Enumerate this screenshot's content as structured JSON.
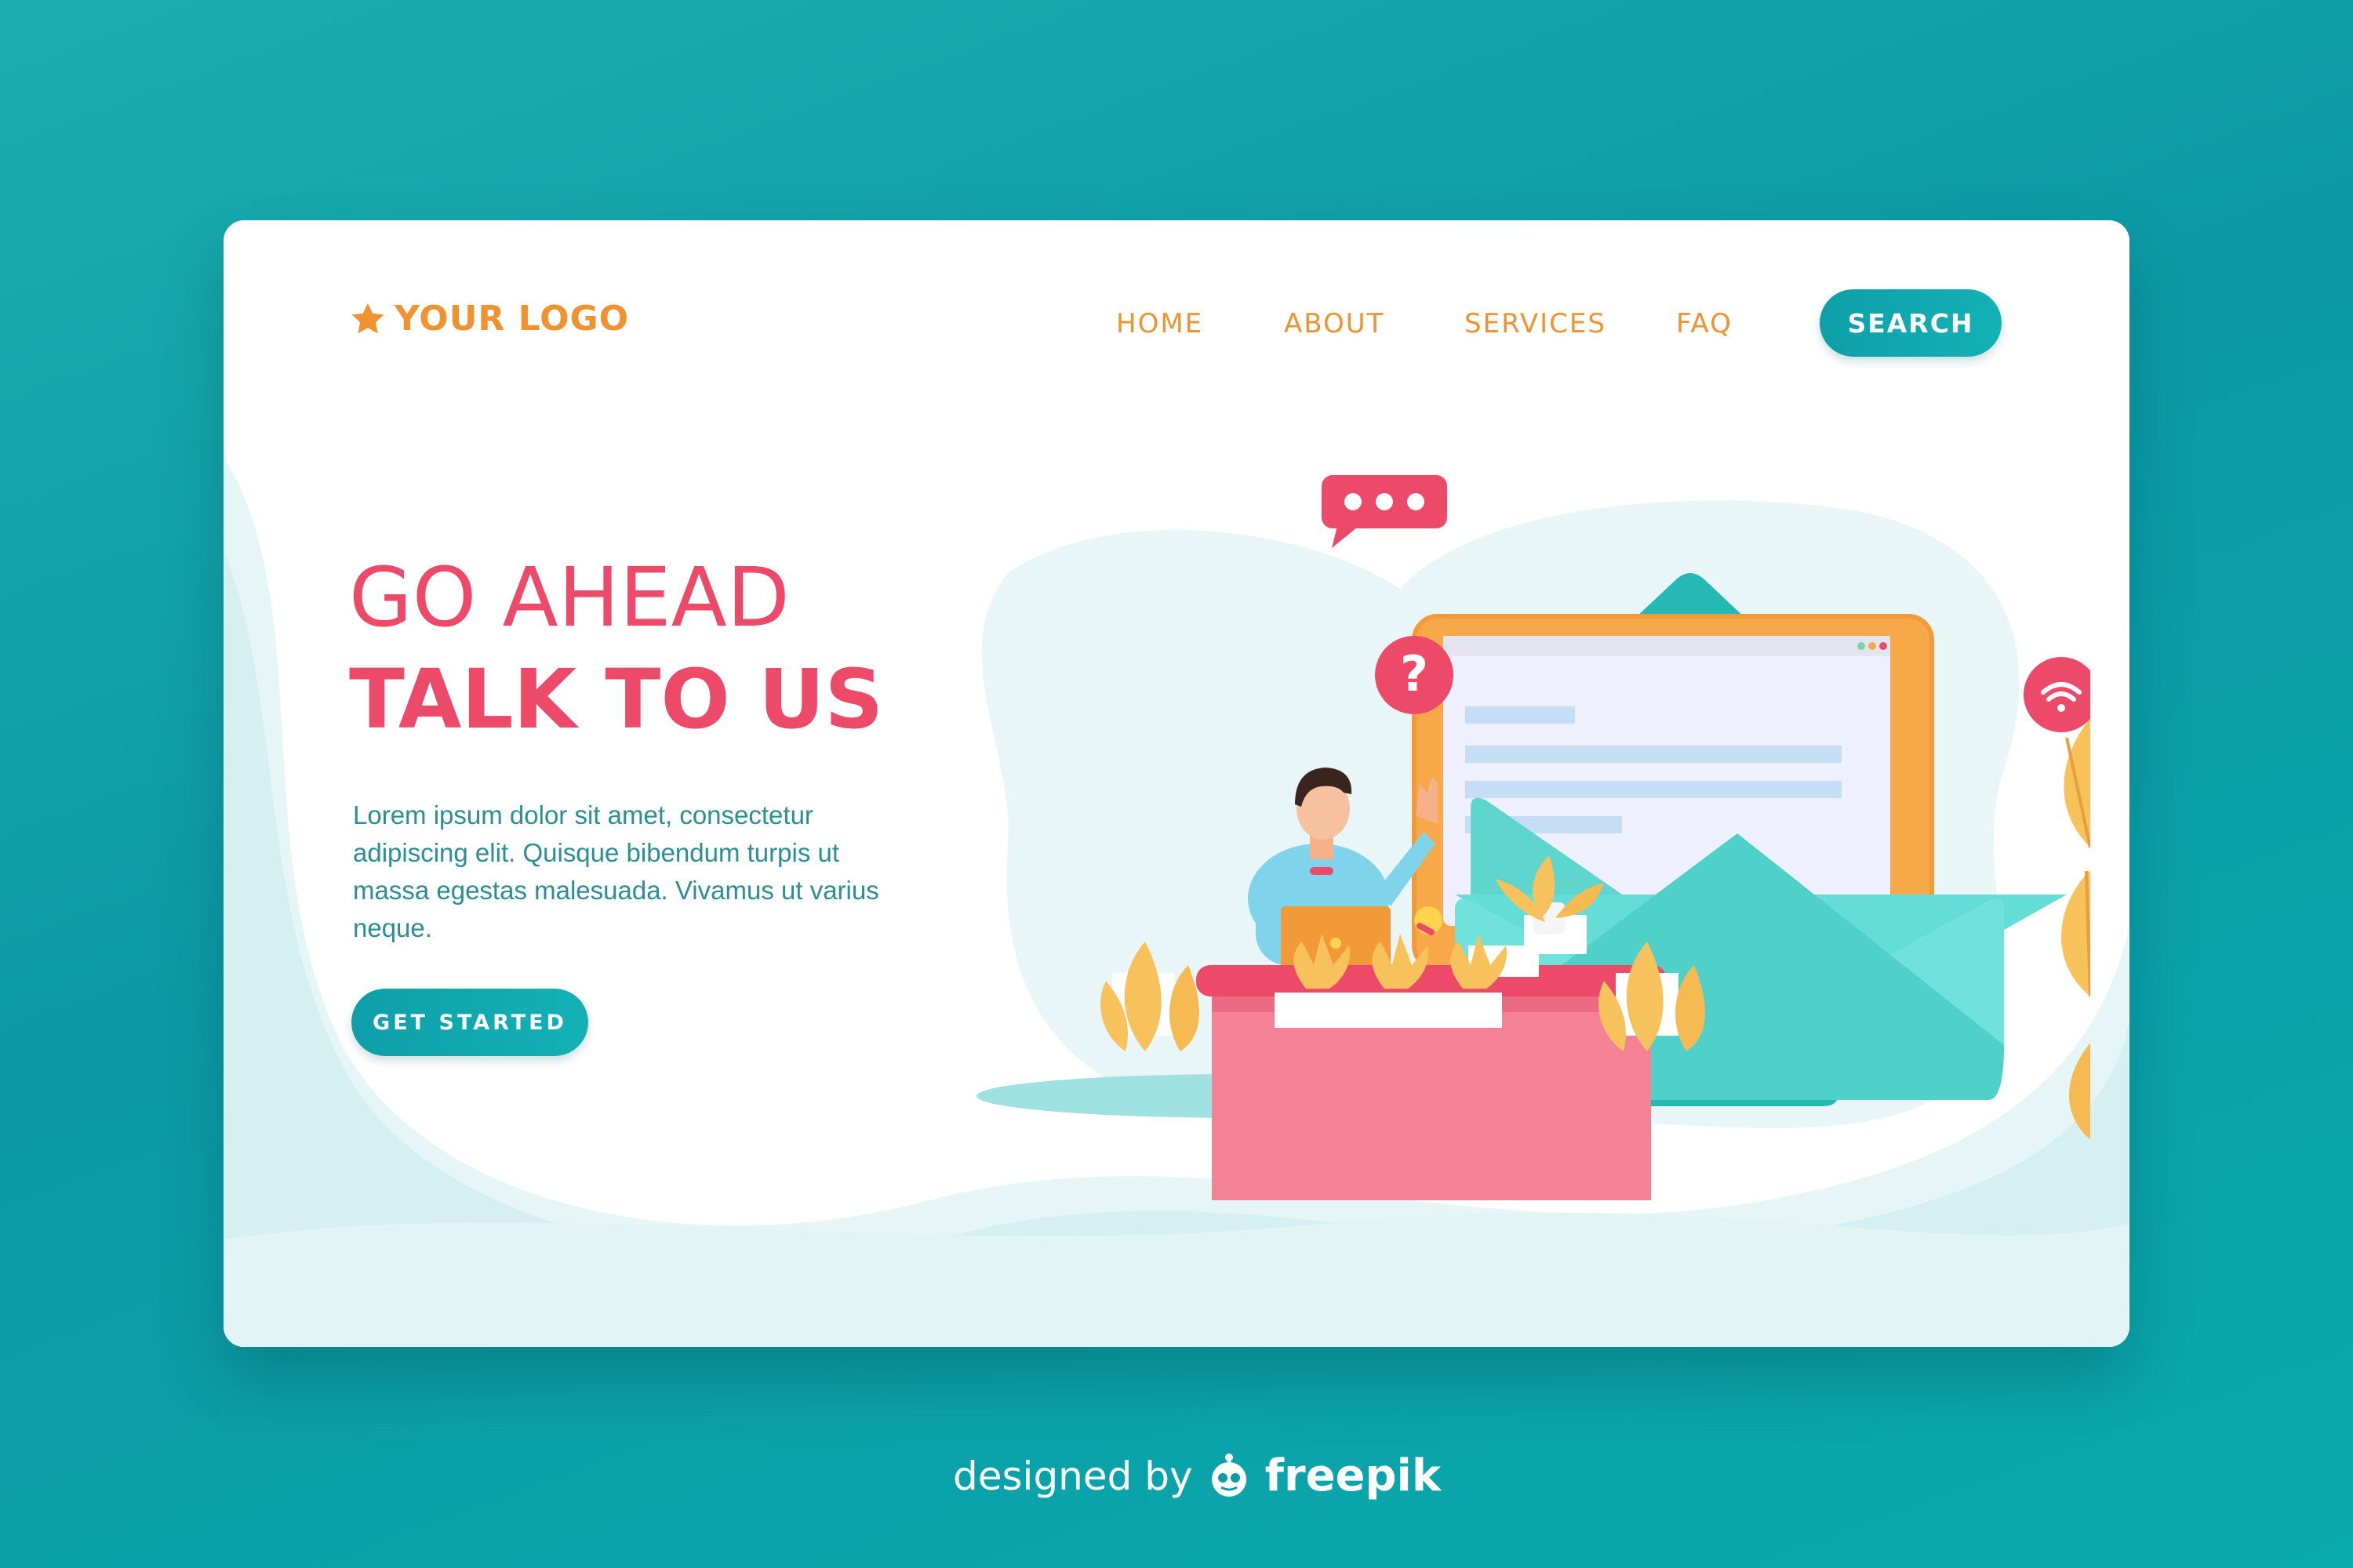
{
  "logo": {
    "icon": "star-icon",
    "text": "YOUR LOGO"
  },
  "nav": {
    "items": [
      {
        "label": "HOME"
      },
      {
        "label": "ABOUT"
      },
      {
        "label": "SERVICES"
      },
      {
        "label": "FAQ"
      }
    ],
    "search_label": "SEARCH"
  },
  "hero": {
    "line1": "GO AHEAD",
    "line2": "TALK TO US",
    "body": "Lorem ipsum dolor sit amet, consectetur adipiscing elit. Quisque bibendum turpis ut massa egestas malesuada. Vivamus ut varius neque.",
    "cta_label": "GET STARTED"
  },
  "illustration": {
    "icons": [
      "chat-bubble-icon",
      "question-icon",
      "wifi-icon",
      "envelope-icon",
      "person-icon",
      "laptop-icon",
      "plant-icon"
    ]
  },
  "credit": {
    "designed": "designed by",
    "brand": "freepik",
    "icon": "freepik-logo-icon"
  },
  "colors": {
    "background": "#0b9aa6",
    "accent_orange": "#f0922f",
    "accent_pink": "#ec4a68",
    "teal_button": "#0e9fa9",
    "body_text": "#2a8e96"
  }
}
